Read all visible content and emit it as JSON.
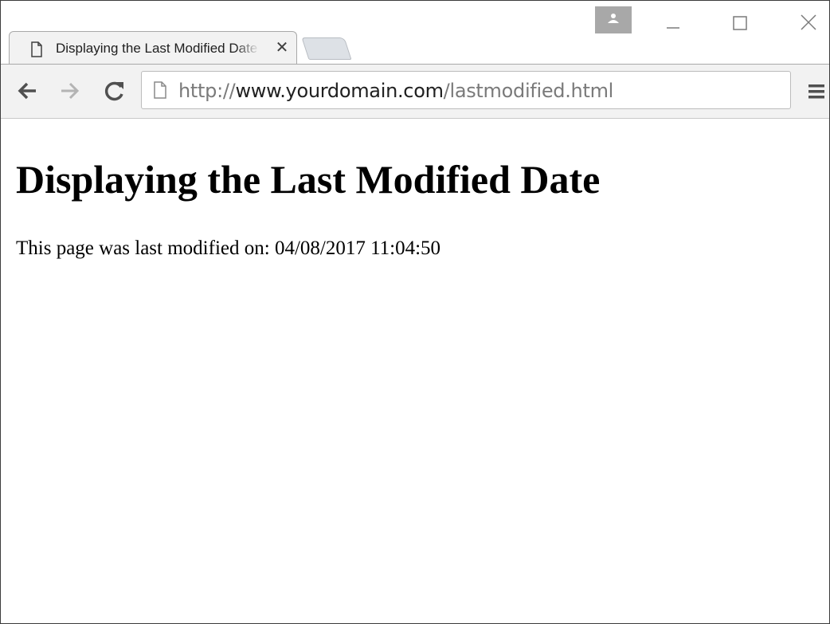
{
  "tab": {
    "title": "Displaying the Last Modified Date",
    "close_glyph": "✕",
    "icon": "page-icon"
  },
  "window_controls": {
    "profile_icon": "person-icon",
    "minimize_icon": "minimize-icon",
    "maximize_icon": "maximize-icon",
    "close_icon": "close-icon"
  },
  "toolbar": {
    "back_icon": "arrow-left-icon",
    "forward_icon": "arrow-right-icon",
    "reload_icon": "reload-icon",
    "menu_icon": "hamburger-menu-icon",
    "address": {
      "scheme": "http://",
      "host": "www.yourdomain.com",
      "path": "/lastmodified.html"
    }
  },
  "page": {
    "heading": "Displaying the Last Modified Date",
    "text": "This page was last modified on: 04/08/2017 11:04:50"
  },
  "colors": {
    "toolbar_bg": "#f2f2f2",
    "profile_bg": "#a8a8a8",
    "url_dim": "#7a7a7a",
    "url_host": "#202020"
  }
}
